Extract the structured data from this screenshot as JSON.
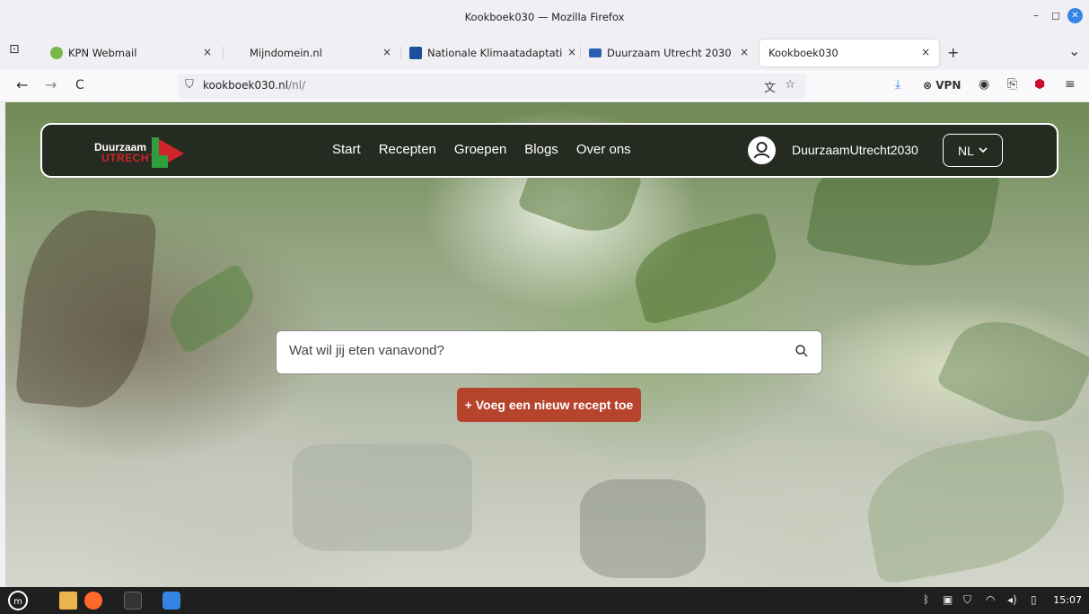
{
  "window": {
    "title": "Kookboek030 — Mozilla Firefox",
    "minimize": "–",
    "maximize": "◻",
    "close": "✕"
  },
  "tabs": [
    {
      "label": "KPN Webmail",
      "favicon_color": "#7ab648"
    },
    {
      "label": "Mijndomein.nl",
      "favicon_color": "#e8e8e8"
    },
    {
      "label": "Nationale Klimaatadaptatie",
      "favicon_color": "#1f4e9a"
    },
    {
      "label": "Duurzaam Utrecht 2030",
      "favicon_color": "#2a5fb0"
    },
    {
      "label": "Kookboek030",
      "favicon_color": "#ffffff",
      "active": true
    }
  ],
  "tab_close": "×",
  "new_tab": "+",
  "tab_list": "⌄",
  "nav": {
    "back": "←",
    "forward": "→",
    "reload": "C",
    "url_host": "kookboek030.nl",
    "url_path": "/nl/",
    "vpn_label": "VPN"
  },
  "site": {
    "logo_line1": "Duurzaam",
    "logo_line2": "UTRECHT",
    "menu": [
      "Start",
      "Recepten",
      "Groepen",
      "Blogs",
      "Over ons"
    ],
    "username": "DuurzaamUtrecht2030",
    "language": "NL",
    "search_placeholder": "Wat wil jij eten vanavond?",
    "add_recipe": "+ Voeg een nieuw recept toe"
  },
  "colors": {
    "header_bg": "#262b22",
    "accent_red": "#d0242b",
    "accent_green": "#2e9e3e",
    "button_bg": "#b6432c"
  },
  "taskbar": {
    "clock": "15:07"
  }
}
